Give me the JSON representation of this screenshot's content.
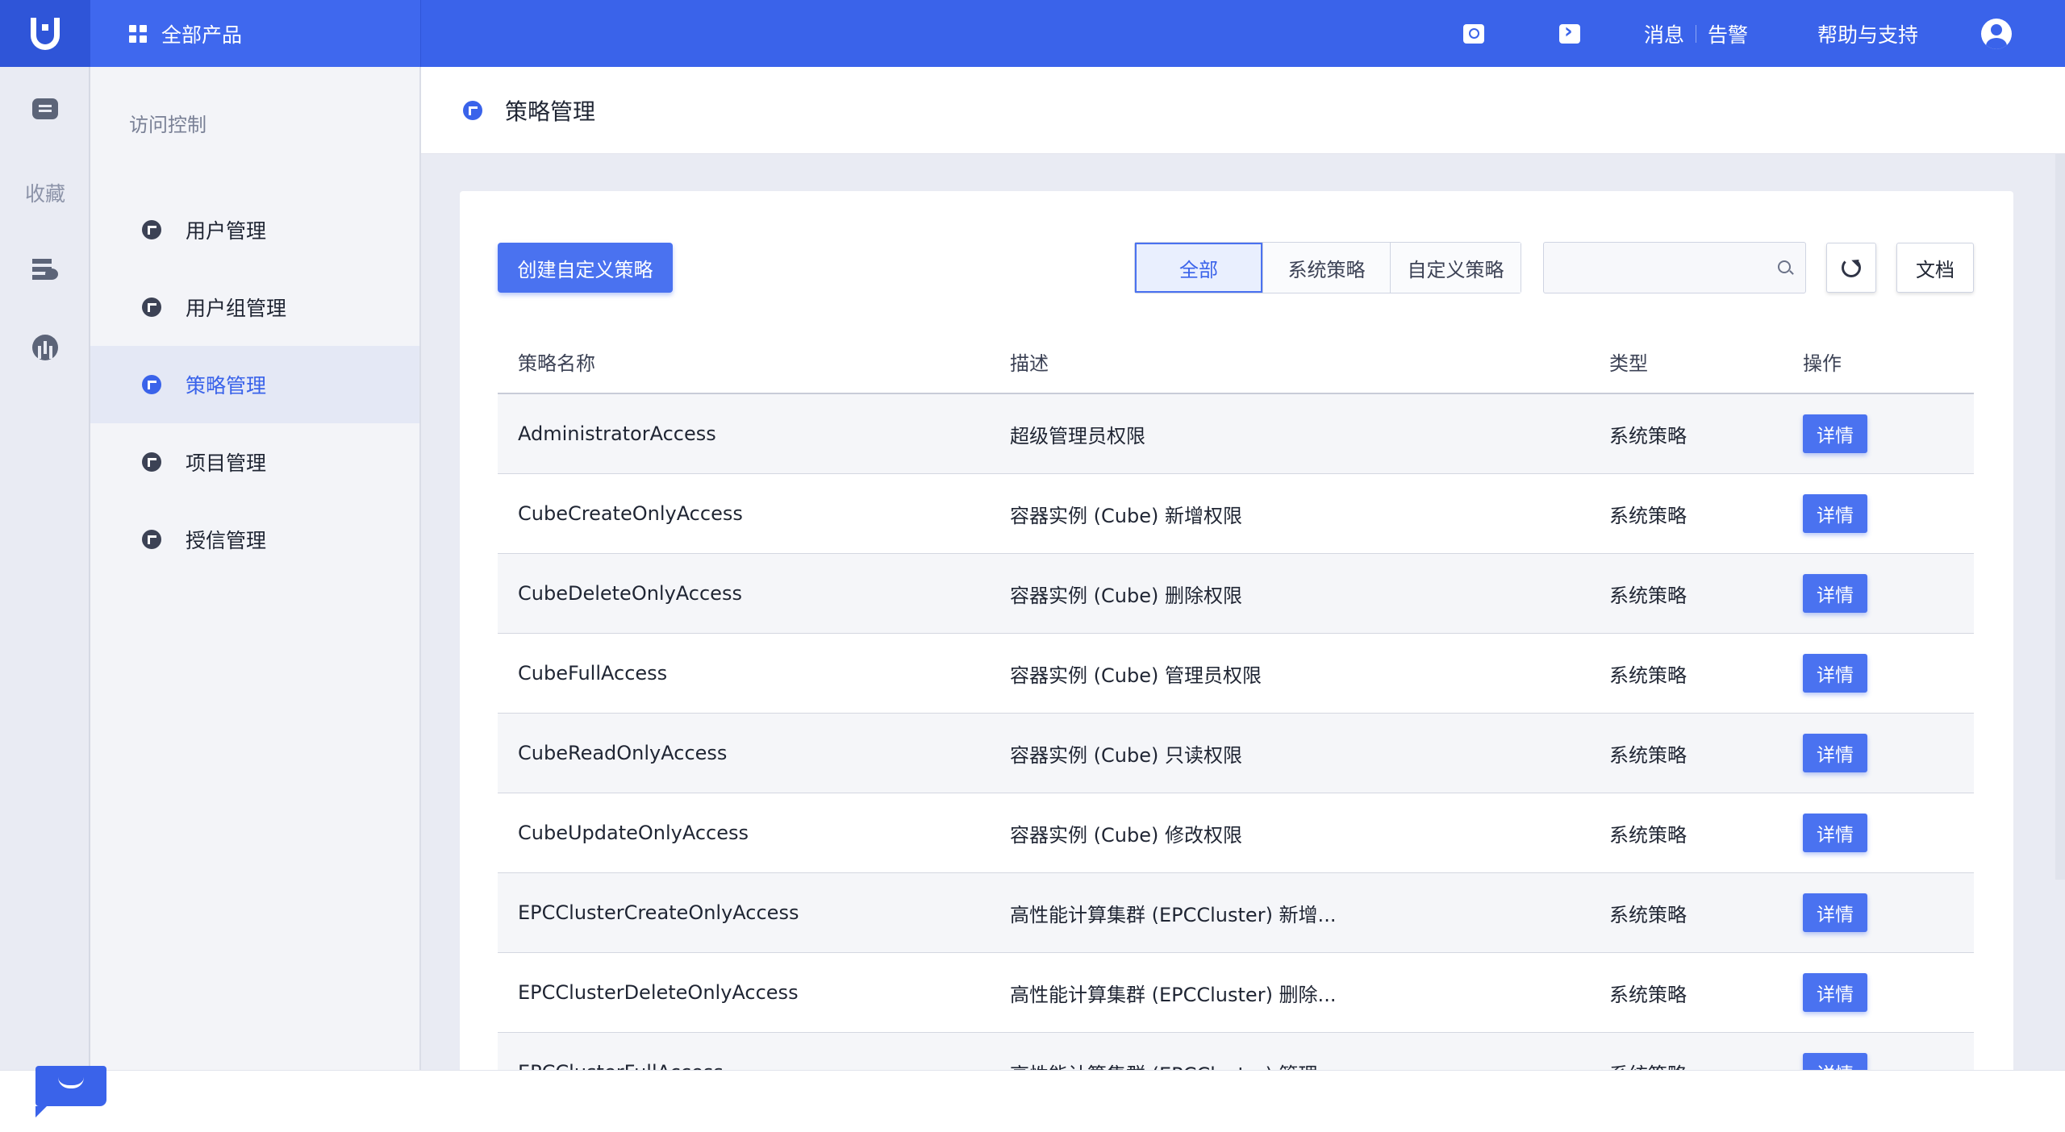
{
  "topbar": {
    "products_label": "全部产品",
    "messages_label": "消息",
    "alerts_label": "告警",
    "help_label": "帮助与支持"
  },
  "rail": {
    "favorites_label": "收藏"
  },
  "sidebar": {
    "title": "访问控制",
    "items": [
      {
        "label": "用户管理",
        "active": false
      },
      {
        "label": "用户组管理",
        "active": false
      },
      {
        "label": "策略管理",
        "active": true
      },
      {
        "label": "项目管理",
        "active": false
      },
      {
        "label": "授信管理",
        "active": false
      }
    ]
  },
  "page": {
    "title": "策略管理"
  },
  "toolbar": {
    "create_label": "创建自定义策略",
    "filters": [
      {
        "label": "全部",
        "active": true
      },
      {
        "label": "系统策略",
        "active": false
      },
      {
        "label": "自定义策略",
        "active": false
      }
    ],
    "search_placeholder": "",
    "doc_label": "文档"
  },
  "table": {
    "headers": {
      "name": "策略名称",
      "desc": "描述",
      "type": "类型",
      "op": "操作"
    },
    "detail_label": "详情",
    "rows": [
      {
        "name": "AdministratorAccess",
        "desc": "超级管理员权限",
        "type": "系统策略"
      },
      {
        "name": "CubeCreateOnlyAccess",
        "desc": "容器实例 (Cube) 新增权限",
        "type": "系统策略"
      },
      {
        "name": "CubeDeleteOnlyAccess",
        "desc": "容器实例 (Cube) 删除权限",
        "type": "系统策略"
      },
      {
        "name": "CubeFullAccess",
        "desc": "容器实例 (Cube) 管理员权限",
        "type": "系统策略"
      },
      {
        "name": "CubeReadOnlyAccess",
        "desc": "容器实例 (Cube) 只读权限",
        "type": "系统策略"
      },
      {
        "name": "CubeUpdateOnlyAccess",
        "desc": "容器实例 (Cube) 修改权限",
        "type": "系统策略"
      },
      {
        "name": "EPCClusterCreateOnlyAccess",
        "desc": "高性能计算集群 (EPCCluster) 新增...",
        "type": "系统策略"
      },
      {
        "name": "EPCClusterDeleteOnlyAccess",
        "desc": "高性能计算集群 (EPCCluster) 删除...",
        "type": "系统策略"
      },
      {
        "name": "EPCClusterFullAccess",
        "desc": "高性能计算集群 (EPCCluster) 管理...",
        "type": "系统策略"
      }
    ]
  },
  "colors": {
    "brand": "#3a63ea",
    "button": "#4a72f0",
    "sidebar_active_bg": "#e4e8f5"
  }
}
